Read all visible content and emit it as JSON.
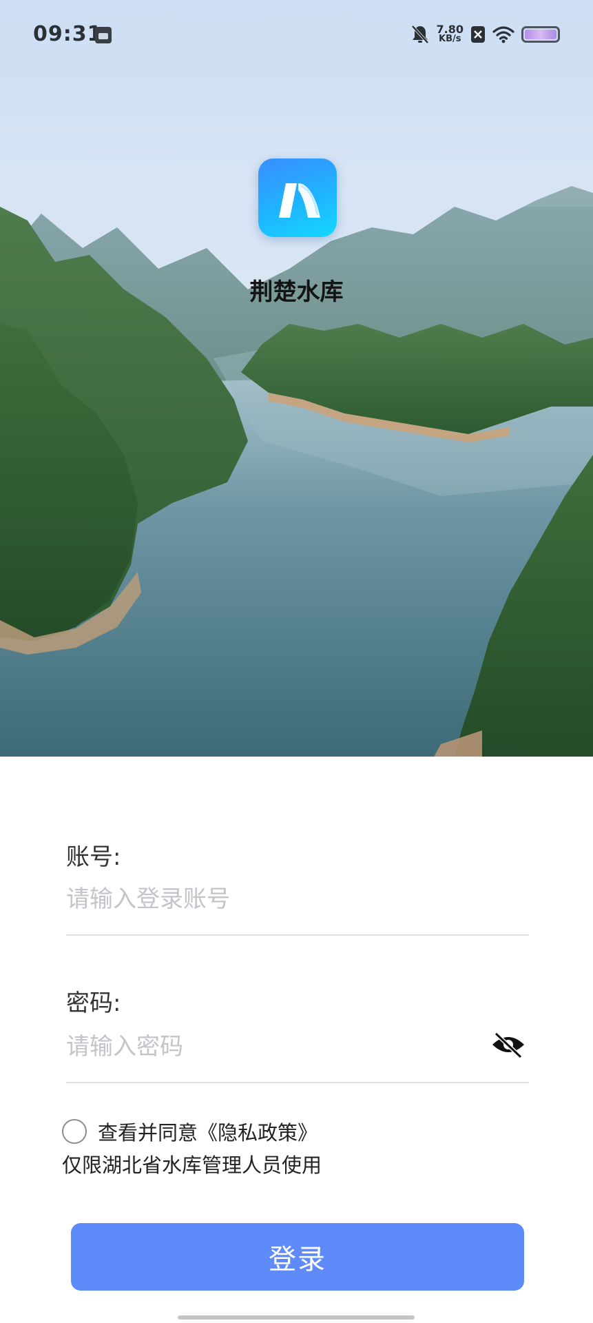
{
  "status_bar": {
    "time": "09:31",
    "net_speed_value": "7.80",
    "net_speed_unit": "KB/s",
    "icons": [
      "app-notification-icon",
      "mute-icon",
      "close-x-icon",
      "wifi-icon",
      "battery-icon"
    ]
  },
  "app": {
    "name": "荆楚水库",
    "logo_icon": "app-logo-icon"
  },
  "form": {
    "account_label": "账号:",
    "account_placeholder": "请输入登录账号",
    "account_value": "",
    "password_label": "密码:",
    "password_placeholder": "请输入密码",
    "password_value": "",
    "password_toggle_icon": "eye-off-icon"
  },
  "agreement": {
    "checked": false,
    "prefix": "查看并同意",
    "policy_link": "《隐私政策》",
    "restriction_note": "仅限湖北省水库管理人员使用"
  },
  "login_button_label": "登录",
  "colors": {
    "accent": "#5f8bfa",
    "logo_gradient_start": "#3a8dff",
    "logo_gradient_end": "#14d8ff"
  }
}
